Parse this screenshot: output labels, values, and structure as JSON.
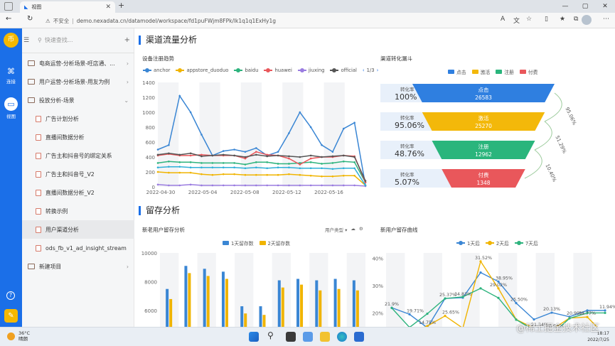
{
  "browser": {
    "tab_title": "视图",
    "url_insecure": "不安全",
    "url_text": "demo.nexadata.cn/datamodel/workspace/fd1puFWjm8FPk/lk1q1q1ExHy1g"
  },
  "rail": {
    "logo_text": "币",
    "items": [
      {
        "label": "连接",
        "icon": "link-icon"
      },
      {
        "label": "视图",
        "icon": "tv-icon"
      }
    ]
  },
  "tree": {
    "search_placeholder": "快速查找...",
    "nodes": [
      {
        "label": "电商运营-分析场景-旺店通、..."
      },
      {
        "label": "用户运营-分析场景-用友为例"
      },
      {
        "label": "投放分析-场景"
      },
      {
        "label": "广告计划分析"
      },
      {
        "label": "直播间数据分析"
      },
      {
        "label": "广告主和抖音号的绑定关系"
      },
      {
        "label": "广告主和抖音号_V2"
      },
      {
        "label": "直播间数据分析_V2"
      },
      {
        "label": "转换示例"
      },
      {
        "label": "用户渠道分析"
      },
      {
        "label": "ods_fb_v1_ad_insight_stream"
      },
      {
        "label": "新建项目"
      }
    ]
  },
  "sections": {
    "channel_title": "渠道流量分析",
    "retention_title": "留存分析"
  },
  "colors": {
    "anchor": "#3a86d4",
    "appstore_duoduo": "#f0b400",
    "baidu": "#2db37d",
    "huawei": "#e9575b",
    "jiuxing": "#9a7ce0",
    "official": "#555555",
    "ad": "#2fb0d8",
    "click": "#2f7fe0",
    "activate": "#f3b80a",
    "register": "#2ab57c",
    "pay": "#e9575b"
  },
  "charts": {
    "line": {
      "title": "设备注册趋势",
      "page_indicator": "1/3",
      "chart_data": {
        "type": "line",
        "series_names": [
          "anchor",
          "appstore_duoduo",
          "baidu",
          "huawei",
          "jiuxing",
          "official"
        ],
        "x_ticks": [
          "2022-04-30",
          "2022-05-04",
          "2022-05-08",
          "2022-05-12",
          "2022-05-16"
        ],
        "y_ticks": [
          "0",
          "200",
          "400",
          "600",
          "800",
          "1000",
          "1200",
          "1400"
        ],
        "ylim": [
          0,
          1400
        ],
        "n_points": 20,
        "series": [
          {
            "name": "anchor",
            "color": "#3a86d4",
            "values": [
              500,
              560,
              1220,
              1000,
              700,
              420,
              480,
              500,
              470,
              520,
              420,
              470,
              720,
              1000,
              800,
              560,
              470,
              780,
              860,
              20
            ]
          },
          {
            "name": "appstore_duoduo",
            "color": "#f0b400",
            "values": [
              200,
              190,
              190,
              190,
              170,
              160,
              170,
              170,
              160,
              160,
              160,
              160,
              170,
              160,
              150,
              140,
              140,
              150,
              150,
              20
            ]
          },
          {
            "name": "baidu",
            "color": "#2db37d",
            "values": [
              320,
              340,
              330,
              330,
              320,
              320,
              320,
              320,
              300,
              330,
              330,
              310,
              310,
              320,
              330,
              310,
              320,
              340,
              330,
              60
            ]
          },
          {
            "name": "huawei",
            "color": "#e9575b",
            "values": [
              420,
              440,
              420,
              420,
              430,
              420,
              420,
              420,
              380,
              470,
              430,
              420,
              380,
              300,
              380,
              400,
              400,
              420,
              410,
              60
            ]
          },
          {
            "name": "jiuxing",
            "color": "#9a7ce0",
            "values": [
              30,
              20,
              20,
              30,
              20,
              20,
              20,
              20,
              20,
              20,
              20,
              20,
              20,
              20,
              20,
              20,
              20,
              20,
              20,
              10
            ]
          },
          {
            "name": "official",
            "color": "#555555",
            "values": [
              430,
              450,
              430,
              450,
              410,
              420,
              430,
              420,
              400,
              430,
              410,
              420,
              410,
              400,
              420,
              400,
              410,
              420,
              400,
              80
            ]
          },
          {
            "name": "",
            "color": "#2fb0d8",
            "values": [
              260,
              270,
              270,
              260,
              260,
              260,
              260,
              260,
              250,
              260,
              250,
              260,
              260,
              250,
              250,
              250,
              240,
              250,
              250,
              20
            ]
          }
        ]
      }
    },
    "funnel": {
      "title": "渠道转化漏斗",
      "chart_data": {
        "type": "funnel",
        "legend": [
          "点击",
          "激活",
          "注册",
          "付费"
        ],
        "stages": [
          {
            "name": "点击",
            "value": 26583,
            "rate_label": "转化率",
            "rate": "100%"
          },
          {
            "name": "激活",
            "value": 25270,
            "rate_label": "转化率",
            "rate": "95.06%"
          },
          {
            "name": "注册",
            "value": 12962,
            "rate_label": "转化率",
            "rate": "48.76%"
          },
          {
            "name": "付费",
            "value": 1348,
            "rate_label": "转化率",
            "rate": "5.07%"
          }
        ],
        "step_rates": [
          "95.06%",
          "51.29%",
          "10.40%"
        ]
      }
    },
    "bar": {
      "title": "新老用户留存分析",
      "filter_label": "用户类型",
      "chart_data": {
        "type": "bar",
        "series_names": [
          "1天留存数",
          "2天留存数"
        ],
        "y_ticks": [
          "4000",
          "6000",
          "8000",
          "10000"
        ],
        "ylim": [
          3000,
          10000
        ],
        "groups": [
          {
            "a": 7500,
            "b": 6800
          },
          {
            "a": 9100,
            "b": 8600
          },
          {
            "a": 8900,
            "b": 8400
          },
          {
            "a": 8700,
            "b": 8200
          },
          {
            "a": 6300,
            "b": 5800
          },
          {
            "a": 6300,
            "b": 5700
          },
          {
            "a": 8100,
            "b": 7600
          },
          {
            "a": 8200,
            "b": 7800
          },
          {
            "a": 8100,
            "b": 7400
          },
          {
            "a": 8200,
            "b": 7500
          },
          {
            "a": 8100,
            "b": 7400
          }
        ]
      }
    },
    "retention": {
      "title": "新用户留存曲线",
      "chart_data": {
        "type": "line",
        "series_names": [
          "1天后",
          "2天后",
          "7天后"
        ],
        "y_ticks": [
          "10%",
          "20%",
          "30%",
          "40%"
        ],
        "ylim": [
          5,
          42
        ],
        "series": [
          {
            "name": "1天后",
            "values": [
              21.9,
              19.5,
              14.6,
              25.3,
              25.6,
              34.8,
              31.5,
              23.6,
              17.6,
              20.1,
              18.6,
              20.9,
              20.9
            ]
          },
          {
            "name": "2天后",
            "values": [
              11.5,
              12.5,
              15.2,
              18.9,
              14.4,
              38.9,
              29.0,
              17.6,
              14.4,
              13.8,
              18.1,
              18.5,
              11.9
            ]
          },
          {
            "name": "7天后",
            "values": [
              21.8,
              14.7,
              19.7,
              25.3,
              25.9,
              29.0,
              25.5,
              17.5,
              13.7,
              12.0,
              18.0,
              20.0,
              20.0
            ]
          }
        ],
        "point_labels": [
          "21.9%",
          "21.81%",
          "19.71%",
          "14.75%",
          "25.37%",
          "25.65%",
          "34.83%",
          "31.52%",
          "38.95%",
          "29.02%",
          "25.50%",
          "21.14%",
          "20.13%",
          "20.99%",
          "20.99%",
          "13.77%",
          "11.94%"
        ]
      }
    }
  },
  "taskbar": {
    "temp": "36°C",
    "weather": "晴朗",
    "time": "18:17",
    "date": "2022/7/25"
  },
  "watermark": "@稀土掘金技术社区"
}
